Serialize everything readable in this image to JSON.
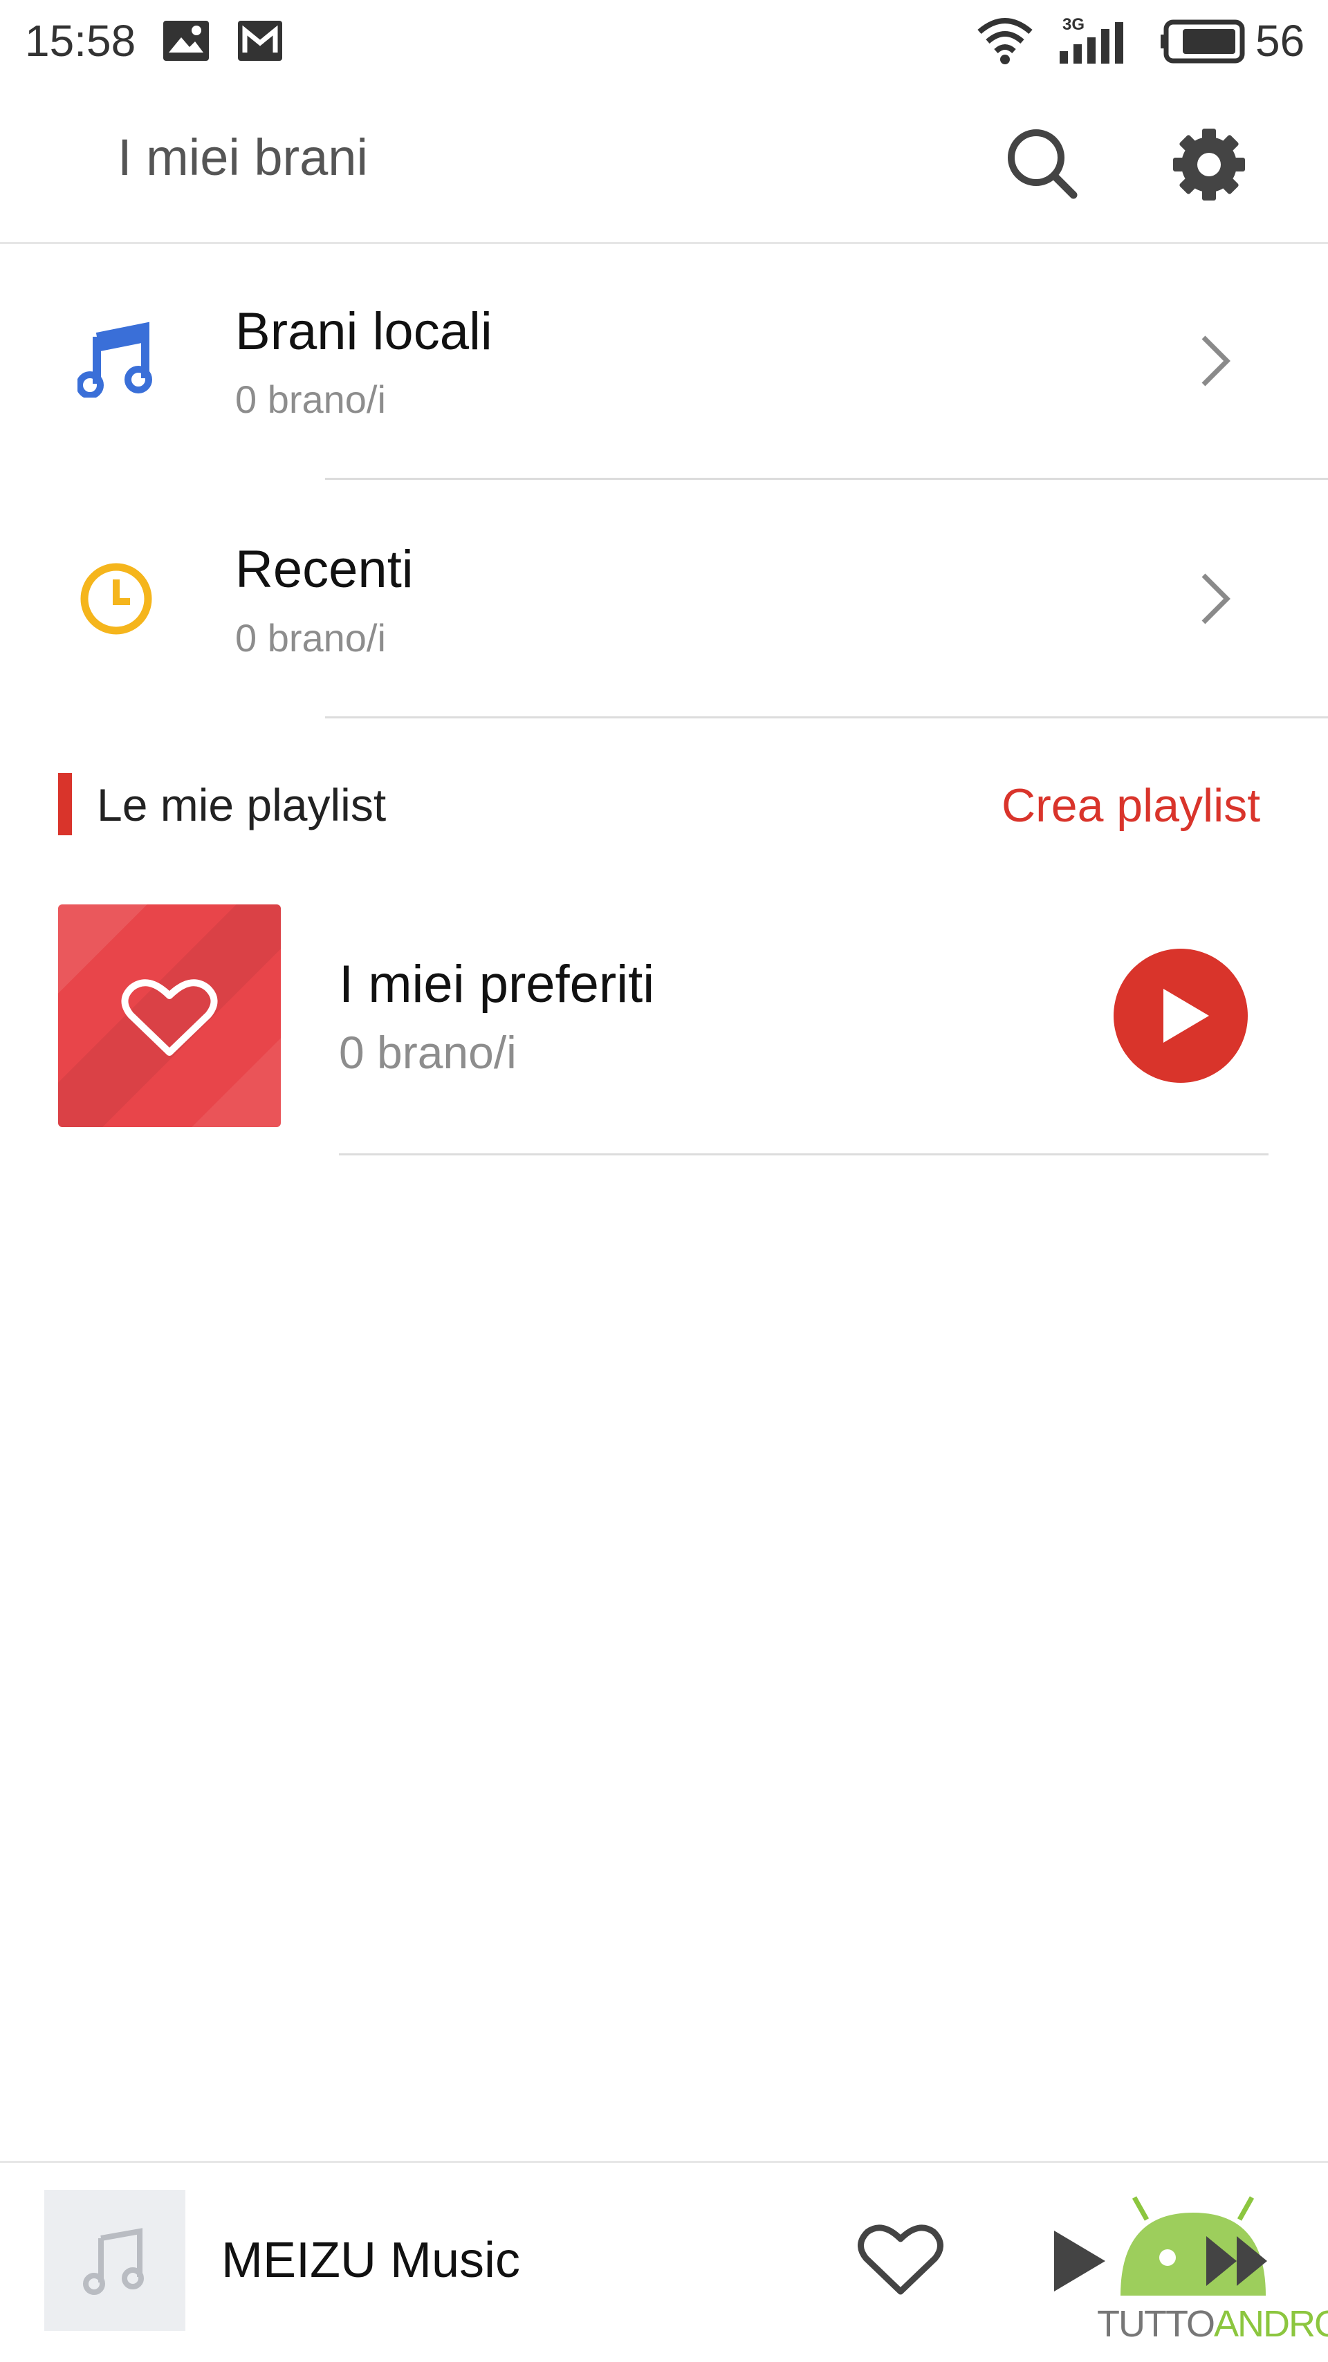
{
  "status_bar": {
    "time": "15:58",
    "network": "3G",
    "battery": "56"
  },
  "header": {
    "title": "I miei brani",
    "search_icon": "search-icon",
    "settings_icon": "gear-icon"
  },
  "library": [
    {
      "icon": "music-note-icon",
      "icon_color": "#3a6fd8",
      "title": "Brani locali",
      "subtitle": "0 brano/i"
    },
    {
      "icon": "clock-icon",
      "icon_color": "#f5b51c",
      "title": "Recenti",
      "subtitle": "0 brano/i"
    }
  ],
  "playlists": {
    "section_title": "Le mie playlist",
    "create_label": "Crea playlist",
    "accent": "#d9342b",
    "items": [
      {
        "title": "I miei preferiti",
        "subtitle": "0 brano/i",
        "cover_icon": "heart-icon",
        "action_icon": "play-icon"
      }
    ]
  },
  "player": {
    "title": "MEIZU Music",
    "thumb_icon": "music-note-icon",
    "favorite_icon": "heart-icon",
    "play_icon": "play-icon",
    "next_icon": "next-icon"
  },
  "watermark": {
    "part1": "TUTTO",
    "part2": "ANDROID"
  }
}
